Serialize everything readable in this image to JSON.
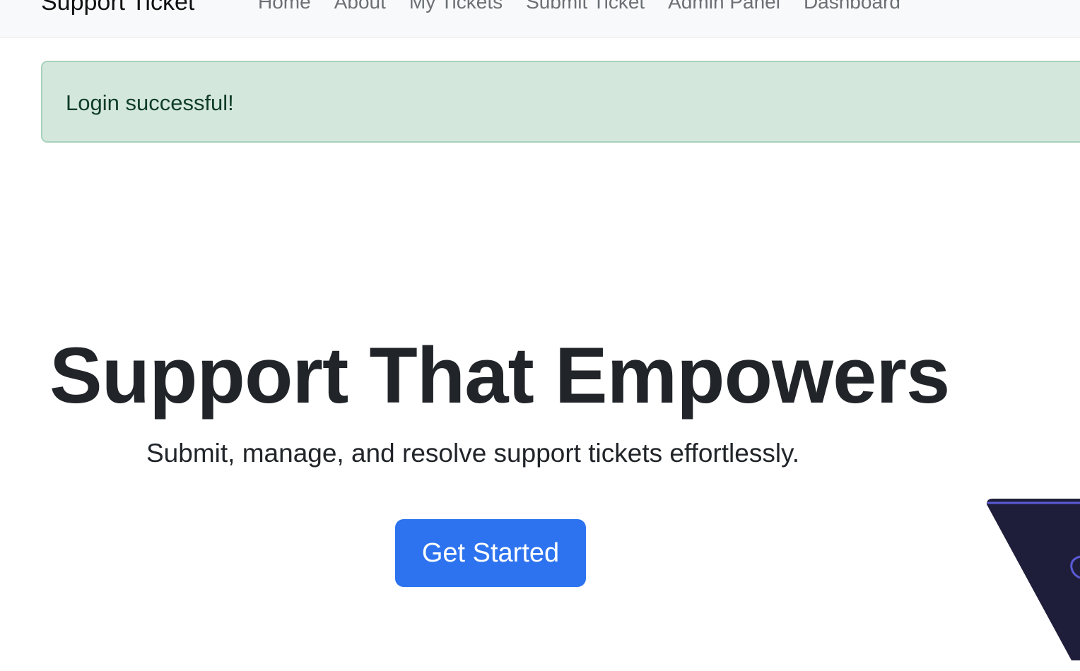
{
  "navbar": {
    "brand": "Support Ticket",
    "links": [
      {
        "label": "Home"
      },
      {
        "label": "About"
      },
      {
        "label": "My Tickets"
      },
      {
        "label": "Submit Ticket"
      },
      {
        "label": "Admin Panel"
      },
      {
        "label": "Dashboard"
      }
    ]
  },
  "alert": {
    "message": "Login successful!",
    "type": "success"
  },
  "hero": {
    "title": "Support That Empowers",
    "subtitle": "Submit, manage, and resolve support tickets effortlessly.",
    "cta_label": "Get Started",
    "illustration_icon": "support-illustration"
  },
  "colors": {
    "navbar_bg": "#f8f9fa",
    "alert_bg": "#d4e7dd",
    "alert_border": "#a9d2bc",
    "primary": "#2d73ef",
    "illustration_dark": "#1e1e3a",
    "illustration_accent": "#5a5ad6"
  }
}
